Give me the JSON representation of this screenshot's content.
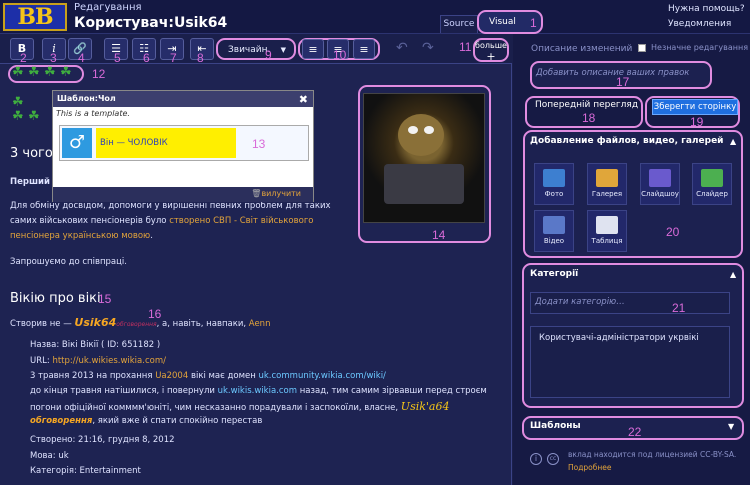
{
  "header": {
    "logo": "BB",
    "editing_label": "Редагування",
    "page_title": "Користувач:Usik64",
    "help": "Нужна помощь?",
    "notifications": "Уведомления",
    "tabs": {
      "source": "Source",
      "visual": "Visual"
    }
  },
  "toolbar": {
    "bold": "B",
    "italic": "i",
    "format_select": "Звичайн.",
    "more_line1": "больше",
    "more_line2": "+"
  },
  "editor": {
    "section_heading_1": "3 чого",
    "bold_first": "Перший",
    "para1_line1": "Для обміну досвідом, допомоги у вирішенні певних проблем для таких",
    "para1_line2": "самих військових пенсіонерів було",
    "para1_link": "створено СВП - Світ військового",
    "para1_link2": "пенсіонера українською мовою",
    "para1_end": ".",
    "invite": "Запрошуємо до співпраці.",
    "section_heading_2": "Вікію про вікі",
    "created_prefix": "Створив не —",
    "usik_sig": "Usik64",
    "usik_small": "обговорення",
    "created_mid": ", а, навіть, навпаки,",
    "aenn_link": "Aenn",
    "name_line": "Назва: Вікі Вікії ( ID: 651182 )",
    "url_label": "URL:",
    "url_link": "http://uk.wikies.wikia.com/",
    "may_line_start": "3 травня 2013 на прохання",
    "ua_link": "Ua2004",
    "may_line_mid": "вікі має домен",
    "domain_link": "uk.community.wikia.com/wiki/",
    "line_b_start": "до кінця травня натішилися, і повернули",
    "line_b_link": "uk.wikis.wikia.com",
    "line_b_end": "назад, тим самим зірвавши перед строєм",
    "line_c": "погони офіційної комммм'юніті, чим несказанно порадували і заспокоїли, власне,",
    "usik_sig2": "Usik'a64",
    "usik_small2": "обговорення",
    "line_d": ", який вже й спати спокійно перестав",
    "created_line": "Створено: 21:16, грудня 8, 2012",
    "language_line": "Мова: uk",
    "category_line": "Категорія: Entertainment"
  },
  "template_popup": {
    "title": "Шаблон:Чол",
    "note": "This is a template.",
    "symbol": "♂",
    "text": "Він — ЧОЛОВІК",
    "delete": "вилучити"
  },
  "sidebar": {
    "summary_label": "Описание изменений",
    "minor_label": "Незначне редагування",
    "summary_placeholder": "Добавить описание ваших правок",
    "preview_button": "Попередній перегляд",
    "save_button": "Зберегти сторінку",
    "media_title": "Добавление файлов, видео, галерей",
    "media": [
      "Фото",
      "Галерея",
      "Слайдшоу",
      "Слайдер",
      "Відео",
      "Таблиця"
    ],
    "categories_title": "Категорії",
    "categories_placeholder": "Додати категорію…",
    "category_item": "Користувачі-адміністратори укрвікі",
    "templates_title": "Шаблоны",
    "license_text": "вклад находится под лицензией CC-BY-SA.",
    "more_link": "Подробнее"
  },
  "annotations": [
    "1",
    "2",
    "3",
    "4",
    "5",
    "6",
    "7",
    "8",
    "9",
    "10",
    "11",
    "12",
    "13",
    "14",
    "15",
    "16",
    "17",
    "18",
    "19",
    "20",
    "21",
    "22"
  ],
  "colors": {
    "background": "#1a1f4b",
    "annotation": "#e08ce0",
    "link": "#e3a43b",
    "save_button": "#1f6fe0"
  }
}
